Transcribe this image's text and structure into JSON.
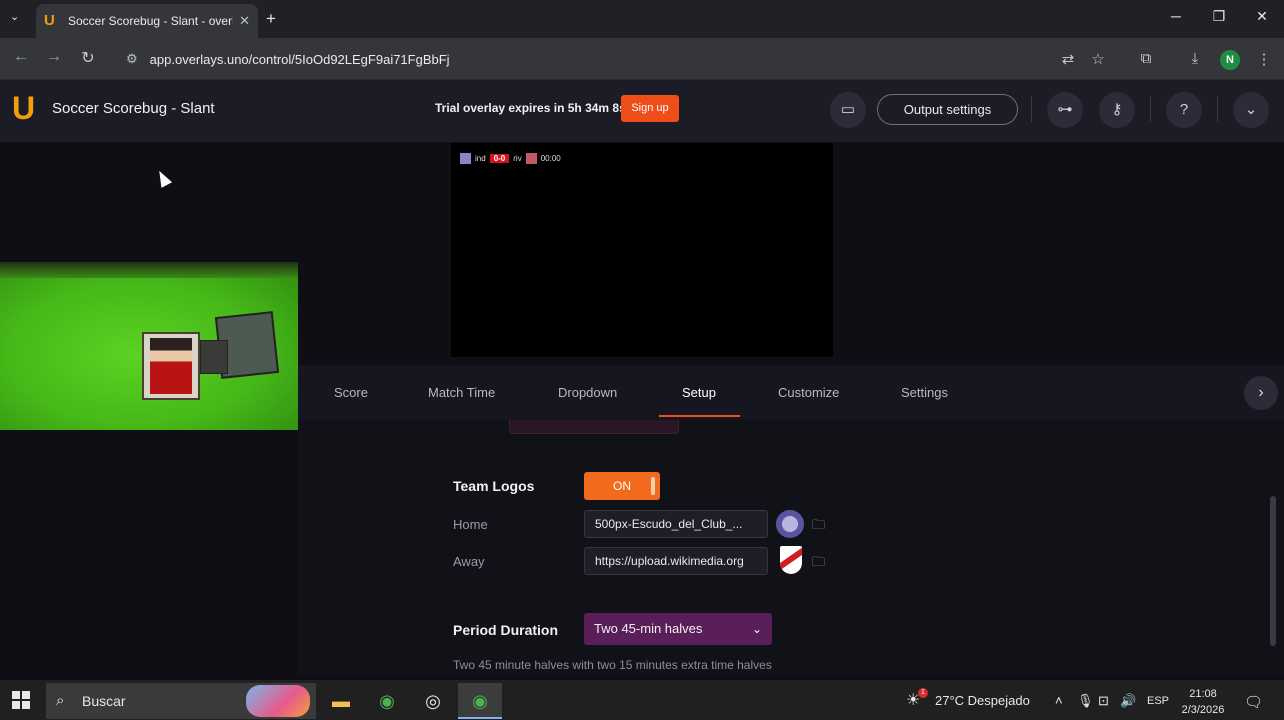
{
  "browser": {
    "tab_title": "Soccer Scorebug - Slant - overl",
    "tab_close": "✕",
    "new_tab": "+",
    "url": "app.overlays.uno/control/5IoOd92LEgF9ai71FgBbFj",
    "profile_initial": "N",
    "window": {
      "minimize": "─",
      "restore": "❐",
      "close": "✕"
    }
  },
  "app": {
    "logo": "U",
    "title": "Soccer Scorebug  -  Slant",
    "trial_text": "Trial overlay expires in 5h 34m 8s",
    "signup_label": "Sign up",
    "output_settings_label": "Output settings",
    "help_label": "?"
  },
  "preview": {
    "home_abbr": "ind",
    "score": "0-0",
    "away_abbr": "riv",
    "clock": "00:00"
  },
  "tabs": [
    {
      "label": "Score"
    },
    {
      "label": "Match Time"
    },
    {
      "label": "Dropdown"
    },
    {
      "label": "Setup",
      "active": true
    },
    {
      "label": "Customize"
    },
    {
      "label": "Settings"
    }
  ],
  "setup": {
    "team_logos_heading": "Team Logos",
    "team_logos_toggle": "ON",
    "home_label": "Home",
    "home_value": "500px-Escudo_del_Club_...",
    "away_label": "Away",
    "away_value": "https://upload.wikimedia.org",
    "period_heading": "Period Duration",
    "period_value": "Two 45-min halves",
    "period_description": "Two 45 minute halves with two 15 minutes extra time halves"
  },
  "taskbar": {
    "search_placeholder": "Buscar",
    "weather_badge": "1",
    "weather": "27°C  Despejado",
    "language": "ESP",
    "time": "21:08",
    "date": "2/3/2026"
  },
  "colors": {
    "accent": "#ef4d1a",
    "toggle_on": "#f26a1b",
    "period_select": "#5a1e58",
    "brand": "#f59e0b"
  }
}
